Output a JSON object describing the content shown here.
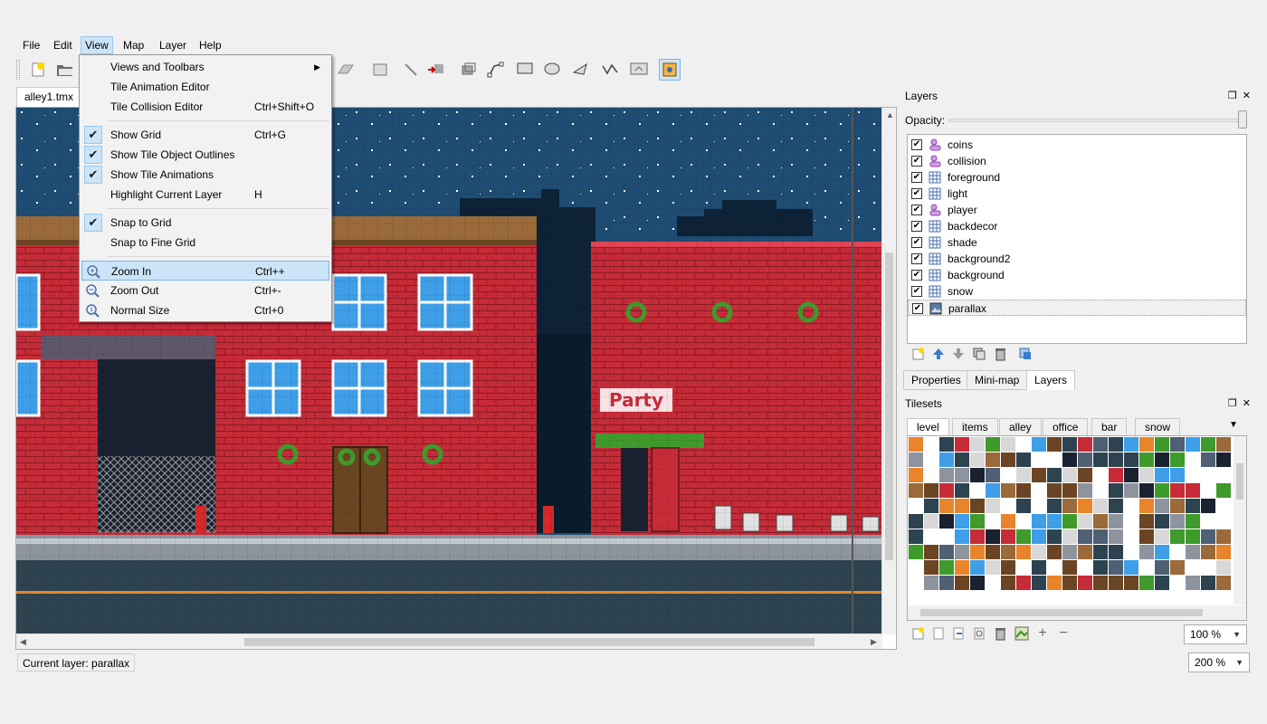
{
  "menubar": [
    "File",
    "Edit",
    "View",
    "Map",
    "Layer",
    "Help"
  ],
  "document_tab": "alley1.tmx",
  "view_menu": {
    "items": [
      {
        "label": "Views and Toolbars",
        "shortcut": "",
        "submenu": true
      },
      {
        "label": "Tile Animation Editor",
        "shortcut": ""
      },
      {
        "label": "Tile Collision Editor",
        "shortcut": "Ctrl+Shift+O"
      },
      {
        "label": "Show Grid",
        "shortcut": "Ctrl+G",
        "checked": true
      },
      {
        "label": "Show Tile Object Outlines",
        "shortcut": "",
        "checked": true
      },
      {
        "label": "Show Tile Animations",
        "shortcut": "",
        "checked": true
      },
      {
        "label": "Highlight Current Layer",
        "shortcut": "H"
      },
      {
        "label": "Snap to Grid",
        "shortcut": "",
        "checked": true
      },
      {
        "label": "Snap to Fine Grid",
        "shortcut": ""
      },
      {
        "label": "Zoom In",
        "shortcut": "Ctrl++",
        "icon": "zoom-in-icon"
      },
      {
        "label": "Zoom Out",
        "shortcut": "Ctrl+-",
        "icon": "zoom-out-icon"
      },
      {
        "label": "Normal Size",
        "shortcut": "Ctrl+0",
        "icon": "zoom-normal-icon"
      }
    ]
  },
  "layers_panel": {
    "title": "Layers",
    "opacity_label": "Opacity:",
    "opacity": 1.0,
    "layers": [
      {
        "name": "coins",
        "type": "object",
        "visible": true
      },
      {
        "name": "collision",
        "type": "object",
        "visible": true
      },
      {
        "name": "foreground",
        "type": "tile",
        "visible": true
      },
      {
        "name": "light",
        "type": "tile",
        "visible": true
      },
      {
        "name": "player",
        "type": "object",
        "visible": true
      },
      {
        "name": "backdecor",
        "type": "tile",
        "visible": true
      },
      {
        "name": "shade",
        "type": "tile",
        "visible": true
      },
      {
        "name": "background2",
        "type": "tile",
        "visible": true
      },
      {
        "name": "background",
        "type": "tile",
        "visible": true
      },
      {
        "name": "snow",
        "type": "tile",
        "visible": true
      },
      {
        "name": "parallax",
        "type": "image",
        "visible": true,
        "selected": true
      }
    ],
    "bottom_tabs": [
      "Properties",
      "Mini-map",
      "Layers"
    ],
    "active_tab": "Layers"
  },
  "tilesets_panel": {
    "title": "Tilesets",
    "tabs": [
      "level",
      "items",
      "alley",
      "office",
      "bar",
      "snow"
    ],
    "active_tab": "level",
    "zoom": "100 %"
  },
  "status": {
    "current_layer": "Current layer: parallax",
    "zoom": "200 %"
  },
  "colors": {
    "sky": "#1f4c72",
    "brick": "#c9313d",
    "selection": "#cce4f7"
  }
}
